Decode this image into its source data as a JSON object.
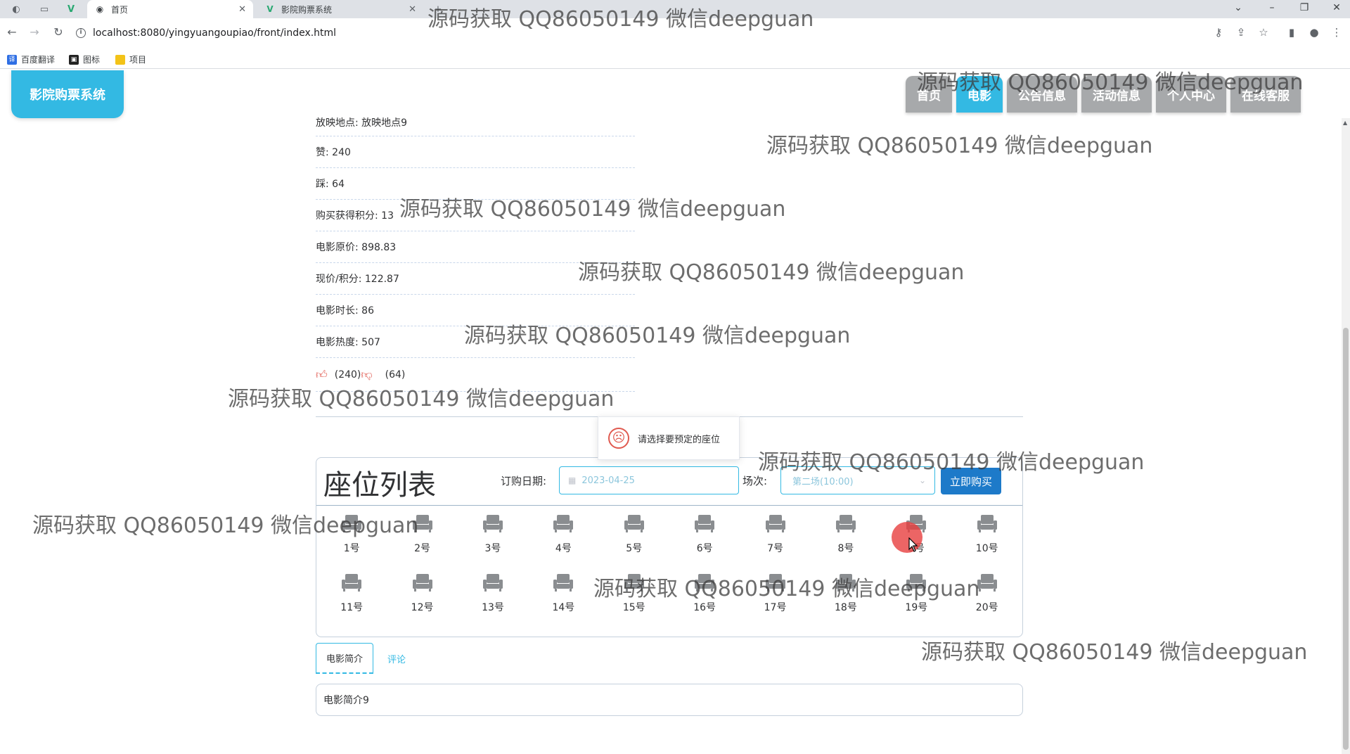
{
  "browser": {
    "tabs": [
      {
        "title": "首页",
        "icon": "globe-icon",
        "active": true
      },
      {
        "title": "影院购票系统",
        "icon": "vue-icon",
        "active": false
      }
    ],
    "url": "localhost:8080/yingyuangoupiao/front/index.html",
    "bookmarks": [
      {
        "label": "百度翻译",
        "icon": "translate-icon",
        "color": "#2f6fe4"
      },
      {
        "label": "图标",
        "icon": "image-icon",
        "color": "#222222"
      },
      {
        "label": "项目",
        "icon": "folder-icon",
        "color": "#f3c318"
      }
    ]
  },
  "header": {
    "logo": "影院购票系统",
    "nav": [
      {
        "label": "首页",
        "active": false
      },
      {
        "label": "电影",
        "active": true
      },
      {
        "label": "公告信息",
        "active": false
      },
      {
        "label": "活动信息",
        "active": false
      },
      {
        "label": "个人中心",
        "active": false
      },
      {
        "label": "在线客服",
        "active": false
      }
    ]
  },
  "movie": {
    "location": "放映地点: 放映地点9",
    "zan": "赞: 240",
    "cai": "踩: 64",
    "points": "购买获得积分: 13",
    "original_price": "电影原价: 898.83",
    "current_price": "现价/积分: 122.87",
    "duration": "电影时长: 86",
    "heat": "电影热度: 507",
    "like_count": "(240)",
    "dislike_count": "(64)"
  },
  "toast": {
    "message": "请选择要预定的座位",
    "icon": "sad-face-icon"
  },
  "seats": {
    "title": "座位列表",
    "date_label": "订购日期:",
    "date_value": "2023-04-25",
    "session_label": "场次:",
    "session_value": "第二场(10:00)",
    "buy_label": "立即购买",
    "seat_color": "#8a8d90",
    "selected_color": "#e73f3f",
    "list": [
      "1号",
      "2号",
      "3号",
      "4号",
      "5号",
      "6号",
      "7号",
      "8号",
      "9号",
      "10号",
      "11号",
      "12号",
      "13号",
      "14号",
      "15号",
      "16号",
      "17号",
      "18号",
      "19号",
      "20号"
    ]
  },
  "detail_tabs": [
    {
      "label": "电影简介",
      "active": true
    },
    {
      "label": "评论",
      "active": false
    }
  ],
  "intro": "电影简介9",
  "watermark": "源码获取 QQ86050149 微信deepguan"
}
